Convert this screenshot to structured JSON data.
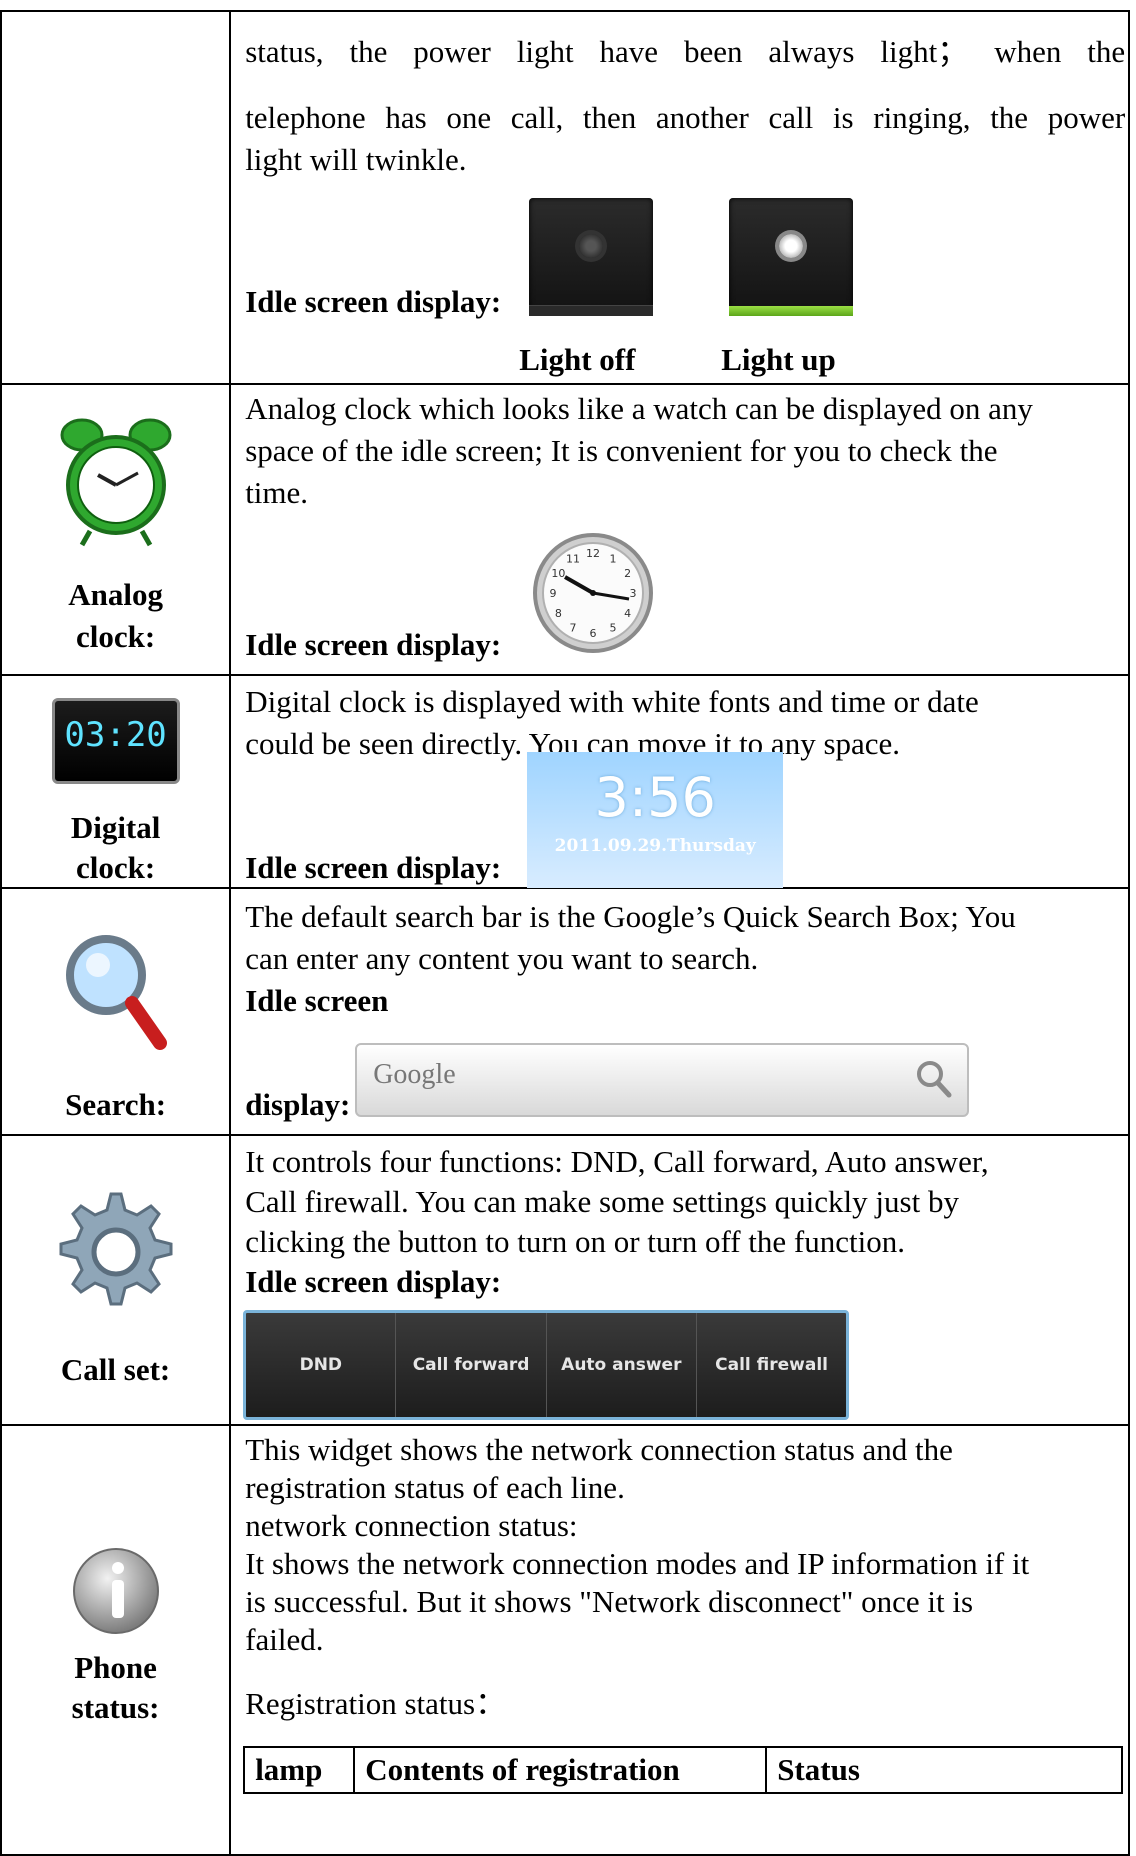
{
  "row_power": {
    "para": "status, the power light have been always light； when the telephone has one call, then another call is ringing, the power light will twinkle.",
    "line1": "status, the power light have been always light； when the",
    "line2": "telephone has one call, then another call is ringing, the power",
    "line3": "light will twinkle.",
    "idle_label": "Idle screen display:",
    "caption_off": "Light off",
    "caption_on": "Light up"
  },
  "row_analog": {
    "label": "Analog clock:",
    "label1": "Analog",
    "label2": "clock:",
    "line1": "Analog clock which looks like a watch can be displayed on any",
    "line2": "space of the idle screen; It is convenient for you to check the",
    "line3": "time.",
    "idle_label": "Idle screen display:",
    "clock_numbers": [
      "12",
      "1",
      "2",
      "3",
      "4",
      "5",
      "6",
      "7",
      "8",
      "9",
      "10",
      "11"
    ]
  },
  "row_digital": {
    "label1": "Digital",
    "label2": "clock:",
    "icon_time": "03:20",
    "line1": "Digital clock is displayed with white fonts and time or date",
    "line2": "could be seen directly. You can move it to any space.",
    "idle_label": "Idle screen display:",
    "shot_time": "3:56",
    "shot_date": "2011.09.29.Thursday"
  },
  "row_search": {
    "label": "Search:",
    "line1": "The default search bar is the Google’s Quick Search Box; You",
    "line2": "can enter any content you want to search.",
    "idle1": "Idle screen",
    "idle2": "display:",
    "placeholder": "Google"
  },
  "row_callset": {
    "label": "Call set:",
    "line1": "It controls four functions: DND, Call forward, Auto answer,",
    "line2": "Call firewall. You can make some settings quickly just by",
    "line3": "clicking the button to turn on or turn off the function.",
    "idle_label": "Idle screen display:",
    "buttons": [
      "DND",
      "Call forward",
      "Auto answer",
      "Call firewall"
    ]
  },
  "row_phone": {
    "label1": "Phone",
    "label2": "status:",
    "line1": "This widget shows the network connection status and the",
    "line2": "registration status of each line.",
    "line3": "network connection status:",
    "line4": "It shows the network connection modes and IP information if it",
    "line5": "is successful. But it shows \"Network disconnect\" once it is",
    "line6": "failed.",
    "line7": "Registration status：",
    "table_headers": [
      "lamp",
      "Contents of registration",
      "Status"
    ]
  }
}
